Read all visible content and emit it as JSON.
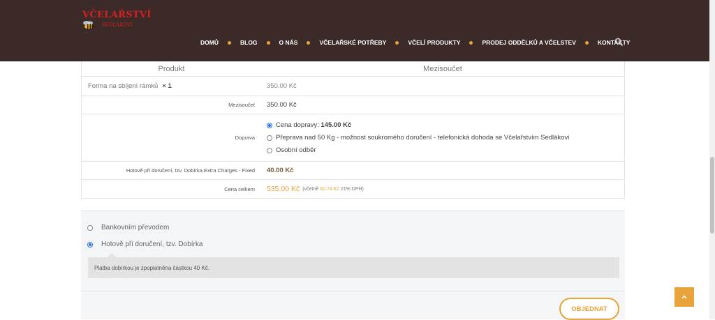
{
  "brand": {
    "title": "VČELAŘSTVÍ",
    "subtitle": "SEDLÁKOVI"
  },
  "nav": {
    "items": [
      "DOMŮ",
      "BLOG",
      "O NÁS",
      "VČELAŘSKÉ POTŘEBY",
      "VČELÍ PRODUKTY",
      "PRODEJ ODDĚLKŮ A VČELSTEV",
      "KONTAKTY"
    ],
    "search_icon": "search-icon"
  },
  "order": {
    "headers": {
      "product": "Produkt",
      "subtotal": "Mezisoučet"
    },
    "item": {
      "name": "Forma na sbíjení rámků",
      "qty": "× 1",
      "price": "350.00 Kč"
    },
    "subtotal": {
      "label": "Mezisoučet",
      "value": "350.00 Kč"
    },
    "shipping": {
      "label": "Doprava",
      "options": [
        {
          "label": "Cena dopravy: ",
          "price": "145.00 Kč",
          "selected": true
        },
        {
          "label": "Přeprava nad 50 Kg - možnost soukromého doručení - telefonická dohoda se Včelařstvím Sedlákovi",
          "selected": false
        },
        {
          "label": "Osobní odběr",
          "selected": false
        }
      ]
    },
    "fee": {
      "label": "Hotově při doručení, tzv. Dobírka Extra Charges - Fixed",
      "value": "40.00 Kč"
    },
    "total": {
      "label": "Cena celkem",
      "value": "535.00 Kč",
      "note_prefix": "(včetně",
      "tax": "60.74 Kč",
      "note_suffix": "21% DPH)"
    }
  },
  "payment": {
    "options": [
      {
        "label": "Bankovním převodem",
        "selected": false
      },
      {
        "label": "Hotově při doručení, tzv. Dobírka",
        "selected": true
      }
    ],
    "description": "Platba dobírkou je zpoplatněna částkou 40 Kč."
  },
  "order_button": "OBJEDNAT",
  "colors": {
    "header_bg": "#3b2a28",
    "accent": "#e8a33a",
    "brand_red": "#d42020"
  }
}
